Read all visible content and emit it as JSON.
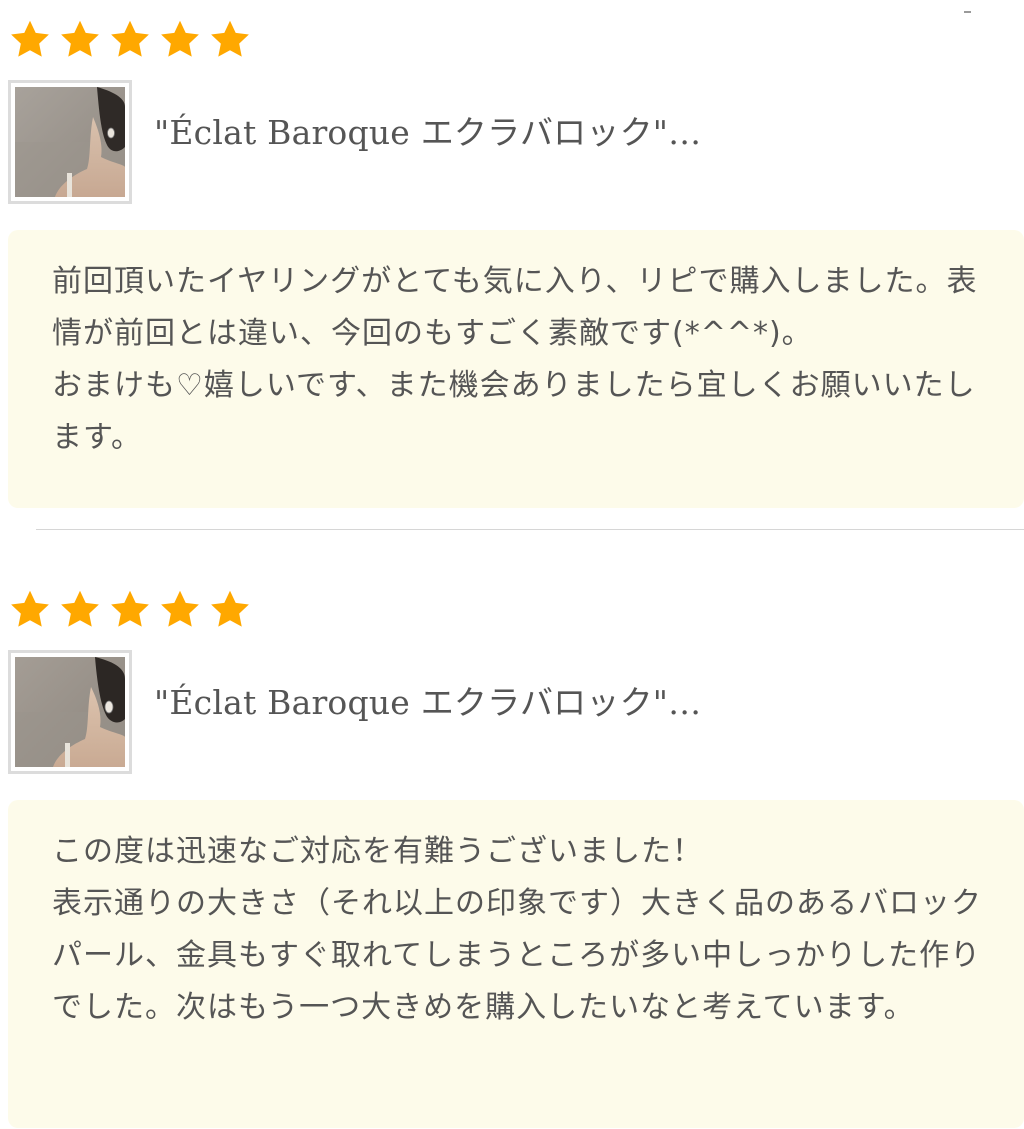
{
  "reviews": [
    {
      "rating": 5,
      "rating_max": 5,
      "product_name": "\"Éclat Baroque エクラバロック\"…",
      "comment": "前回頂いたイヤリングがとても気に入り、リピで購入しました。表情が前回とは違い、今回のもすごく素敵です(*^^*)。\nおまけも♡嬉しいです、また機会ありましたら宜しくお願いいたします。"
    },
    {
      "rating": 5,
      "rating_max": 5,
      "product_name": "\"Éclat Baroque エクラバロック\"…",
      "comment": "この度は迅速なご対応を有難うございました！\n表示通りの大きさ（それ以上の印象です）大きく品のあるバロックパール、金具もすぐ取れてしまうところが多い中しっかりした作りでした。次はもう一つ大きめを購入したいなと考えています。"
    }
  ],
  "colors": {
    "star": "#FFA800",
    "comment_background": "#FDFBEA",
    "text": "#555555",
    "divider": "#D6D6D6"
  },
  "icons": {
    "rating_star": "star-icon",
    "product_thumbnail": "product-photo"
  }
}
